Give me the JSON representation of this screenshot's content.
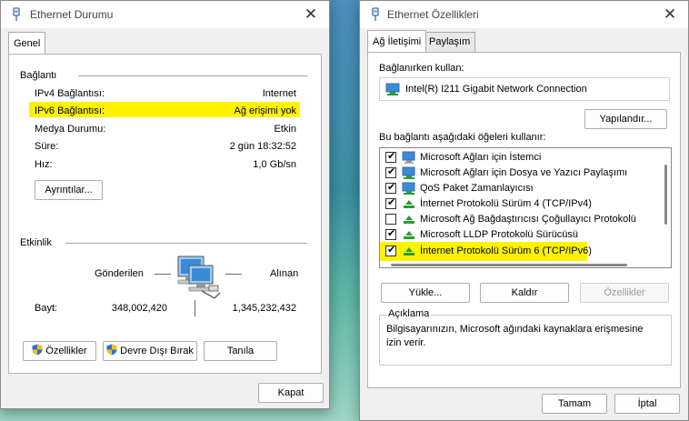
{
  "left_dialog": {
    "title": "Ethernet Durumu",
    "close_glyph": "✕",
    "tab": "Genel",
    "connection_group": "Bağlantı",
    "rows": [
      {
        "label": "IPv4 Bağlantısı:",
        "value": "Internet"
      },
      {
        "label": "IPv6 Bağlantısı:",
        "value": "Ağ erişimi yok"
      },
      {
        "label": "Medya Durumu:",
        "value": "Etkin"
      },
      {
        "label": "Süre:",
        "value": "2 gün 18:32:52"
      },
      {
        "label": "Hız:",
        "value": "1,0 Gb/sn"
      }
    ],
    "details_button": "Ayrıntılar...",
    "activity_group": "Etkinlik",
    "sent_label": "Gönderilen",
    "received_label": "Alınan",
    "bytes_label": "Bayt:",
    "bytes_sent": "348,002,420",
    "bytes_received": "1,345,232,432",
    "properties_button": "Özellikler",
    "disable_button": "Devre Dışı Bırak",
    "diagnose_button": "Tanıla",
    "close_button": "Kapat"
  },
  "right_dialog": {
    "title": "Ethernet Özellikleri",
    "close_glyph": "✕",
    "tabs": [
      "Ağ İletişimi",
      "Paylaşım"
    ],
    "connect_using_label": "Bağlanırken kullan:",
    "adapter_name": "Intel(R) I211 Gigabit Network Connection",
    "configure_button": "Yapılandır...",
    "items_label": "Bu bağlantı aşağıdaki öğeleri kullanır:",
    "items": [
      {
        "label": "Microsoft Ağları için İstemci",
        "checked": true
      },
      {
        "label": "Microsoft Ağları için Dosya ve Yazıcı Paylaşımı",
        "checked": true
      },
      {
        "label": "QoS Paket Zamanlayıcısı",
        "checked": true
      },
      {
        "label": "İnternet Protokolü Sürüm 4 (TCP/IPv4)",
        "checked": true
      },
      {
        "label": "Microsoft Ağ Bağdaştırıcısı Çoğullayıcı Protokolü",
        "checked": false
      },
      {
        "label": "Microsoft LLDP Protokolü Sürücüsü",
        "checked": true
      },
      {
        "label": "İnternet Protokolü Sürüm 6 (TCP/IPv6)",
        "checked": true
      }
    ],
    "install_button": "Yükle...",
    "uninstall_button": "Kaldır",
    "properties_button": "Özellikler",
    "description_group": "Açıklama",
    "description_text": "Bilgisayarınızın, Microsoft ağındaki kaynaklara erişmesine izin verir.",
    "ok_button": "Tamam",
    "cancel_button": "İptal"
  },
  "colors": {
    "highlight": "#fff200",
    "dialog_bg": "#f0f0f0"
  }
}
